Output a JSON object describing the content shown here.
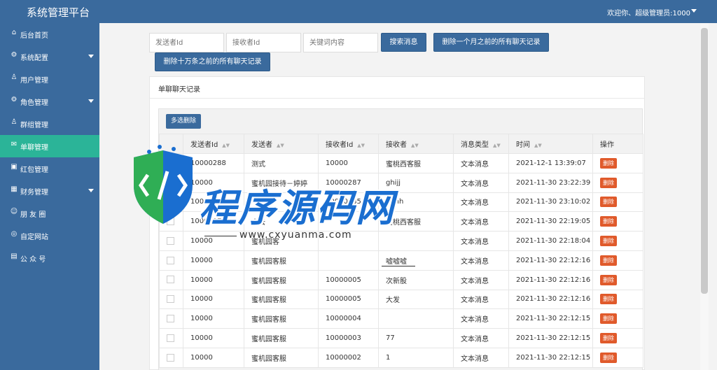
{
  "header": {
    "brand": "系统管理平台",
    "user": "欢迎你、超级管理员:1000"
  },
  "sidebar": {
    "items": [
      {
        "icon": "home-icon",
        "glyph": "⌂",
        "label": "后台首页",
        "caret": false,
        "active": false
      },
      {
        "icon": "gear-icon",
        "glyph": "⚙",
        "label": "系统配置",
        "caret": true,
        "active": false
      },
      {
        "icon": "user-icon",
        "glyph": "♙",
        "label": "用户管理",
        "caret": false,
        "active": false
      },
      {
        "icon": "roles-icon",
        "glyph": "⚙",
        "label": "角色管理",
        "caret": true,
        "active": false
      },
      {
        "icon": "group-icon",
        "glyph": "♙",
        "label": "群组管理",
        "caret": false,
        "active": false
      },
      {
        "icon": "chat-icon",
        "glyph": "✉",
        "label": "单聊管理",
        "caret": false,
        "active": true
      },
      {
        "icon": "redpacket-icon",
        "glyph": "▣",
        "label": "红包管理",
        "caret": false,
        "active": false
      },
      {
        "icon": "finance-icon",
        "glyph": "▦",
        "label": "财务管理",
        "caret": true,
        "active": false
      },
      {
        "icon": "moments-icon",
        "glyph": "☺",
        "label": "朋 友 圈",
        "caret": false,
        "active": false
      },
      {
        "icon": "website-icon",
        "glyph": "◎",
        "label": "自定网站",
        "caret": false,
        "active": false
      },
      {
        "icon": "official-account-icon",
        "glyph": "▤",
        "label": "公 众 号",
        "caret": false,
        "active": false
      }
    ]
  },
  "filters": {
    "sender_placeholder": "发送者Id",
    "receiver_placeholder": "接收者Id",
    "keyword_placeholder": "关键词内容",
    "search_label": "搜索消息",
    "delete_month_label": "删除一个月之前的所有聊天记录",
    "delete_100k_label": "删除十万条之前的所有聊天记录"
  },
  "panel": {
    "title": "单聊聊天记录",
    "batch_delete_label": "多选删除"
  },
  "table": {
    "headers": [
      "发送者Id",
      "发送者",
      "接收者Id",
      "接收者",
      "消息类型",
      "时间",
      "操作"
    ],
    "delete_label": "删除",
    "rows": [
      {
        "checkbox": false,
        "sender_id": "10000288",
        "sender": "测式",
        "receiver_id": "10000",
        "receiver": "蜜桃西客服",
        "type": "文本消息",
        "time": "2021-12-1 13:39:07"
      },
      {
        "checkbox": false,
        "sender_id": "10000",
        "sender": "蜜机园接待－婷婷",
        "receiver_id": "10000287",
        "receiver": "ghijj",
        "type": "文本消息",
        "time": "2021-11-30 23:22:39"
      },
      {
        "checkbox": false,
        "sender_id": "10000",
        "sender": "",
        "receiver_id": "10000285",
        "receiver": "ghhh",
        "type": "文本消息",
        "time": "2021-11-30 23:10:02"
      },
      {
        "checkbox": true,
        "sender_id": "10000071",
        "sender": "小云",
        "receiver_id": "",
        "receiver": "蜜桃西客服",
        "type": "文本消息",
        "time": "2021-11-30 22:19:05"
      },
      {
        "checkbox": true,
        "sender_id": "10000",
        "sender": "蜜机园客",
        "receiver_id": "",
        "receiver": "",
        "type": "文本消息",
        "time": "2021-11-30 22:18:04"
      },
      {
        "checkbox": true,
        "sender_id": "10000",
        "sender": "蜜机园客服",
        "receiver_id": "",
        "receiver": "嘘嘘嘘",
        "type": "文本消息",
        "time": "2021-11-30 22:12:16"
      },
      {
        "checkbox": true,
        "sender_id": "10000",
        "sender": "蜜机园客服",
        "receiver_id": "10000005",
        "receiver": "次新股",
        "type": "文本消息",
        "time": "2021-11-30 22:12:16"
      },
      {
        "checkbox": true,
        "sender_id": "10000",
        "sender": "蜜机园客服",
        "receiver_id": "10000005",
        "receiver": "大发",
        "type": "文本消息",
        "time": "2021-11-30 22:12:16"
      },
      {
        "checkbox": true,
        "sender_id": "10000",
        "sender": "蜜机园客服",
        "receiver_id": "10000004",
        "receiver": "",
        "type": "文本消息",
        "time": "2021-11-30 22:12:15"
      },
      {
        "checkbox": true,
        "sender_id": "10000",
        "sender": "蜜机园客服",
        "receiver_id": "10000003",
        "receiver": "77",
        "type": "文本消息",
        "time": "2021-11-30 22:12:15"
      },
      {
        "checkbox": true,
        "sender_id": "10000",
        "sender": "蜜机园客服",
        "receiver_id": "10000002",
        "receiver": "1",
        "type": "文本消息",
        "time": "2021-11-30 22:12:15"
      }
    ]
  },
  "watermark": {
    "title": "程序源码网",
    "url": "www.cxyuanma.com"
  },
  "colors": {
    "primary": "#3a6a9d",
    "active": "#2bb498",
    "danger": "#e05a2b"
  }
}
